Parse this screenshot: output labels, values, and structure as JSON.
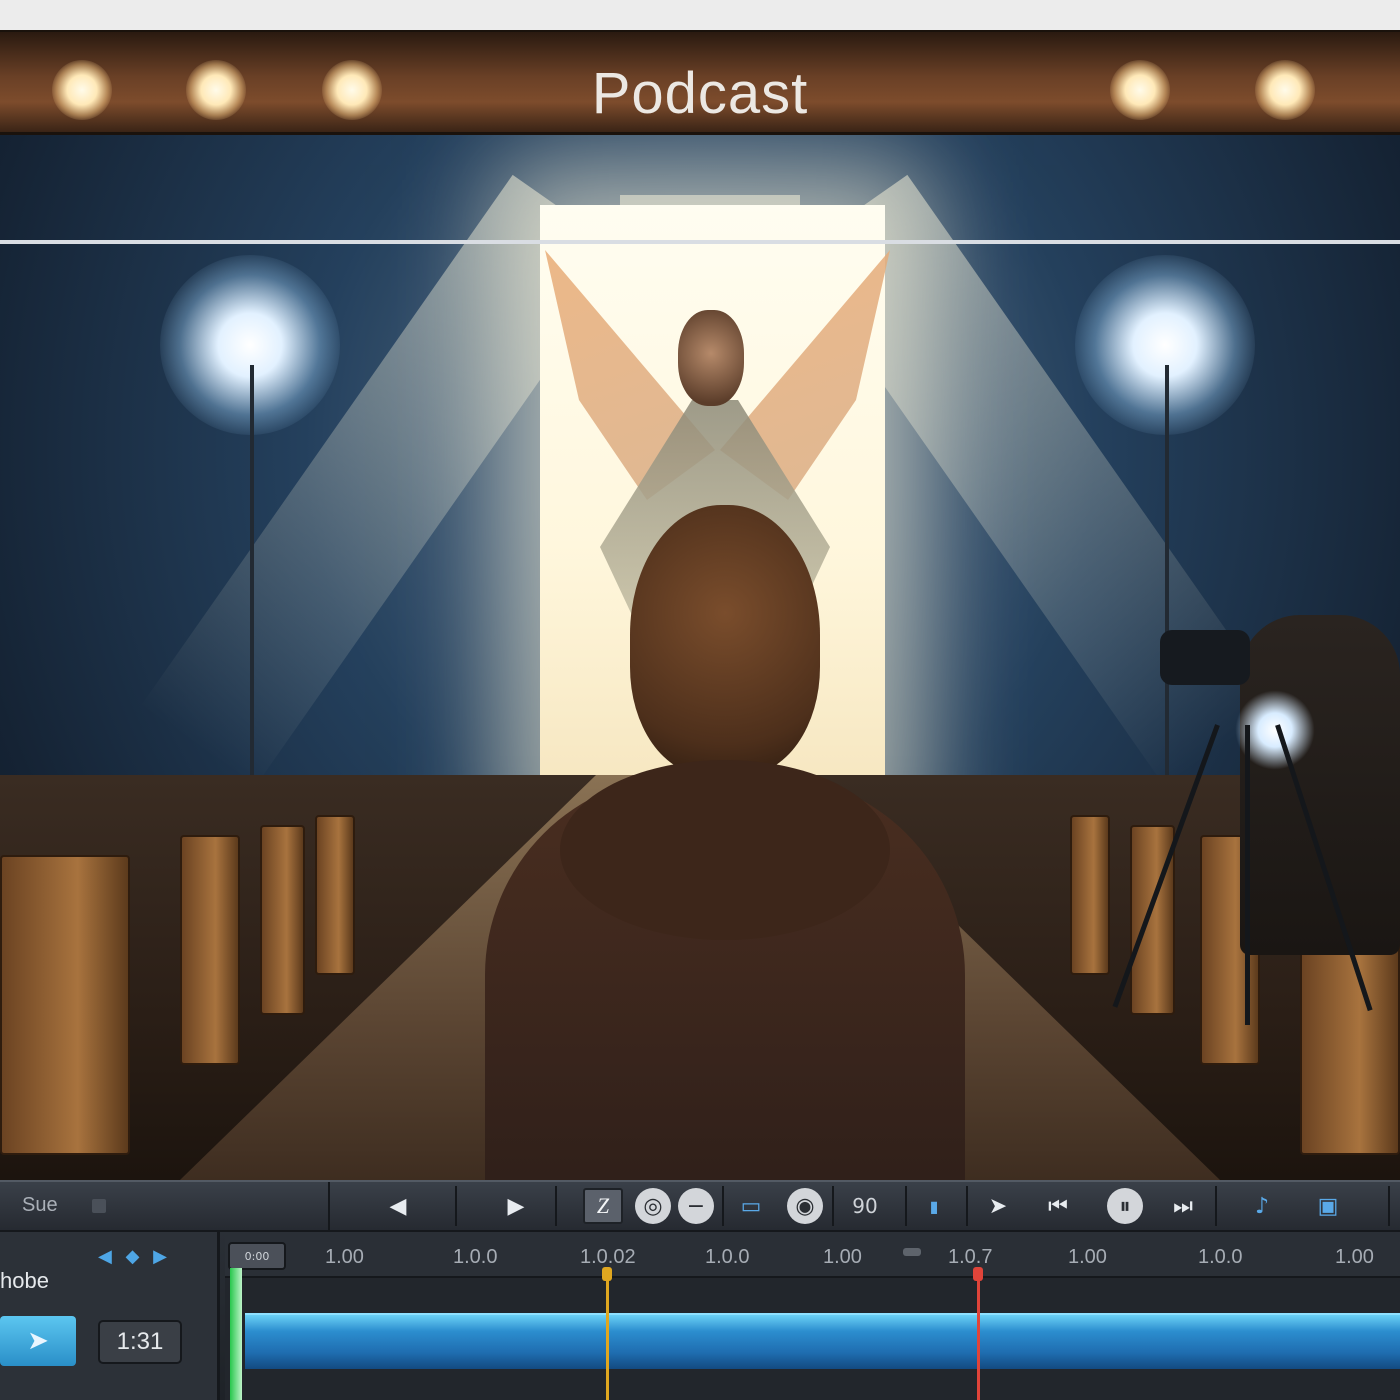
{
  "header": {
    "title": "Podcast"
  },
  "toolbar": {
    "left_label": "Sue",
    "buttons": [
      {
        "name": "prev-arrow",
        "glyph": "◀"
      },
      {
        "name": "next-arrow",
        "glyph": "▶"
      },
      {
        "name": "z-tool",
        "glyph": "Z"
      },
      {
        "name": "record",
        "glyph": "◎"
      },
      {
        "name": "minus",
        "glyph": "−"
      },
      {
        "name": "frame",
        "glyph": "▭"
      },
      {
        "name": "target",
        "glyph": "◉"
      },
      {
        "name": "number",
        "glyph": "90"
      },
      {
        "name": "marker",
        "glyph": "▮"
      },
      {
        "name": "forward",
        "glyph": "➤"
      },
      {
        "name": "skip-back",
        "glyph": "⏮"
      },
      {
        "name": "pause",
        "glyph": "⏸"
      },
      {
        "name": "skip-forward",
        "glyph": "⏭"
      },
      {
        "name": "audio",
        "glyph": "♪"
      },
      {
        "name": "export",
        "glyph": "▣"
      }
    ]
  },
  "timeline": {
    "track_name": "hobe",
    "track_arrows": "◀ ◆ ▶",
    "clip_glyph": "➤",
    "current_time": "1:31",
    "playhead_tag": "0:00",
    "ruler_labels": [
      "1.00",
      "1.0.0",
      "1.0.02",
      "1.0.0",
      "1.00",
      "1.0.7",
      "1.00",
      "1.0.0",
      "1.00"
    ],
    "colors": {
      "accent_blue": "#2c8ecf",
      "marker_yellow": "#e0a720",
      "marker_red": "#e0443a",
      "playhead_green": "#27c74c"
    }
  }
}
